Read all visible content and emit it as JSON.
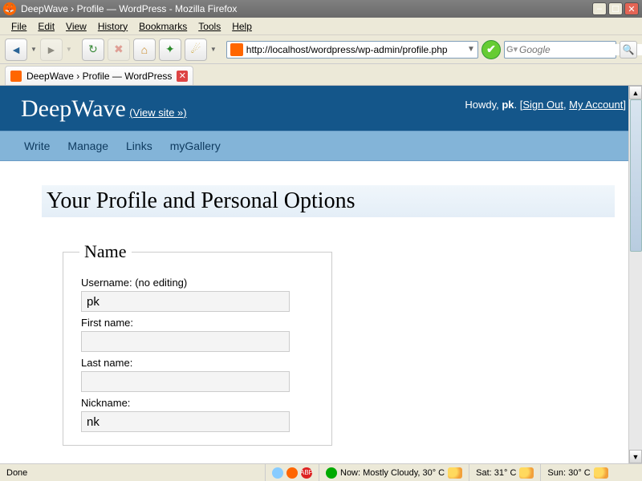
{
  "window": {
    "title": "DeepWave › Profile — WordPress - Mozilla Firefox"
  },
  "menubar": [
    "File",
    "Edit",
    "View",
    "History",
    "Bookmarks",
    "Tools",
    "Help"
  ],
  "url": "http://localhost/wordpress/wp-admin/profile.php",
  "search_placeholder": "Google",
  "search_badge": "G",
  "tab": {
    "title": "DeepWave › Profile — WordPress"
  },
  "wp": {
    "site": "DeepWave",
    "viewsite": "View site »",
    "howdy_prefix": "Howdy, ",
    "user": "pk",
    "after_user": ". [",
    "signout": "Sign Out",
    "sep": ", ",
    "account": "My Account",
    "after_links": "]",
    "nav": [
      "Write",
      "Manage",
      "Links",
      "myGallery"
    ],
    "heading": "Your Profile and Personal Options",
    "fieldset_legend": "Name",
    "fields": {
      "username_label": "Username: (no editing)",
      "username_value": "pk",
      "first_label": "First name:",
      "first_value": "",
      "last_label": "Last name:",
      "last_value": "",
      "nick_label": "Nickname:",
      "nick_value": "nk"
    }
  },
  "status": {
    "done": "Done",
    "now": "Now: Mostly Cloudy, 30° C",
    "sat": "Sat: 31° C",
    "sun": "Sun: 30° C"
  }
}
